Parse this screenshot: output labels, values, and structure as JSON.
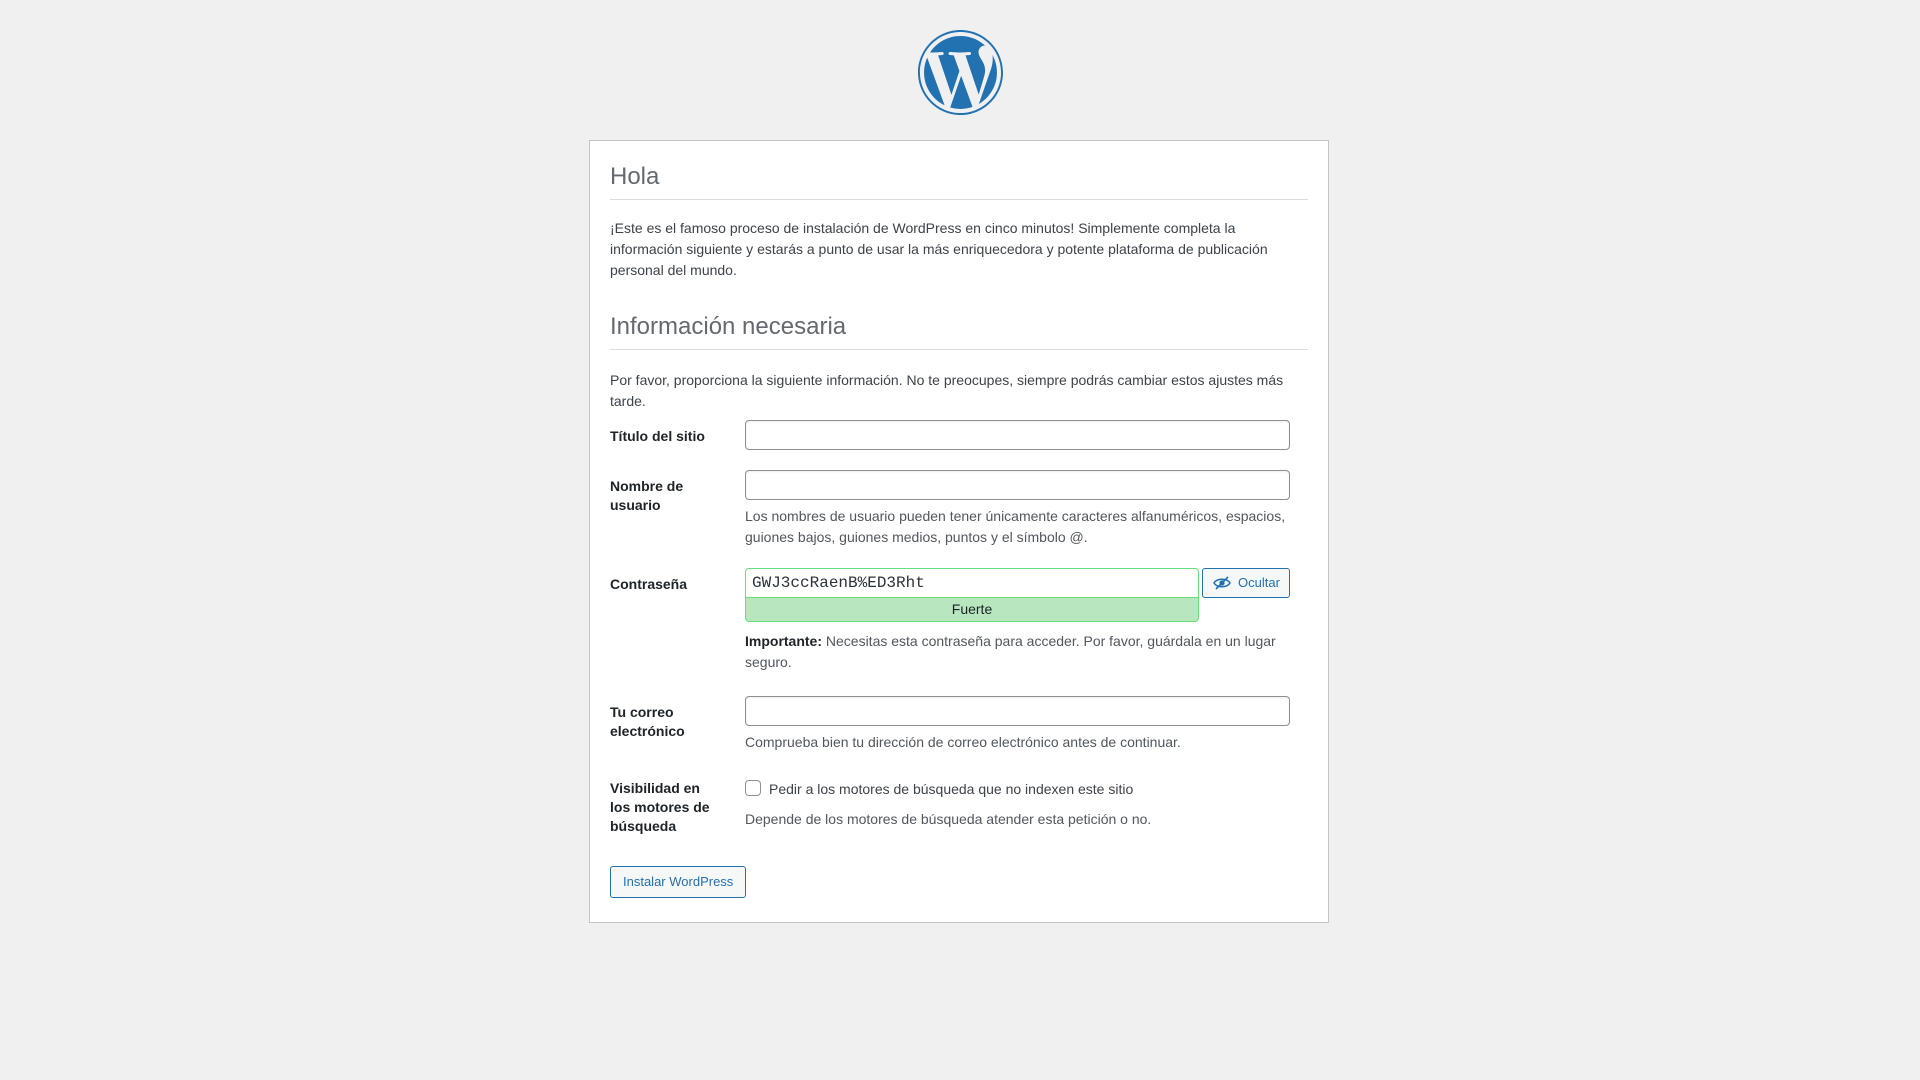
{
  "header": {
    "logo_icon": "wordpress-logo-icon",
    "brand_color": "#2271b1"
  },
  "intro": {
    "title": "Hola",
    "text": "¡Este es el famoso proceso de instalación de WordPress en cinco minutos! Simplemente completa la información siguiente y estarás a punto de usar la más enriquecedora y potente plataforma de publicación personal del mundo."
  },
  "required": {
    "title": "Información necesaria",
    "text": "Por favor, proporciona la siguiente información. No te preocupes, siempre podrás cambiar estos ajustes más tarde."
  },
  "form": {
    "site_title": {
      "label": "Título del sitio",
      "value": ""
    },
    "username": {
      "label": "Nombre de usuario",
      "value": "",
      "description": "Los nombres de usuario pueden tener únicamente caracteres alfanuméricos, espacios, guiones bajos, guiones medios, puntos y el símbolo @."
    },
    "password": {
      "label": "Contraseña",
      "value": "GWJ3ccRaenB%ED3Rht",
      "strength": "Fuerte",
      "toggle_label": "Ocultar",
      "important_label": "Importante:",
      "important_text": " Necesitas esta contraseña para acceder. Por favor, guárdala en un lugar seguro."
    },
    "email": {
      "label": "Tu correo electrónico",
      "value": "",
      "description": "Comprueba bien tu dirección de correo electrónico antes de continuar."
    },
    "visibility": {
      "label": "Visibilidad en los motores de búsqueda",
      "checkbox_label": "Pedir a los motores de búsqueda que no indexen este sitio",
      "checked": false,
      "description": "Depende de los motores de búsqueda atender esta petición o no."
    },
    "submit_label": "Instalar WordPress"
  }
}
